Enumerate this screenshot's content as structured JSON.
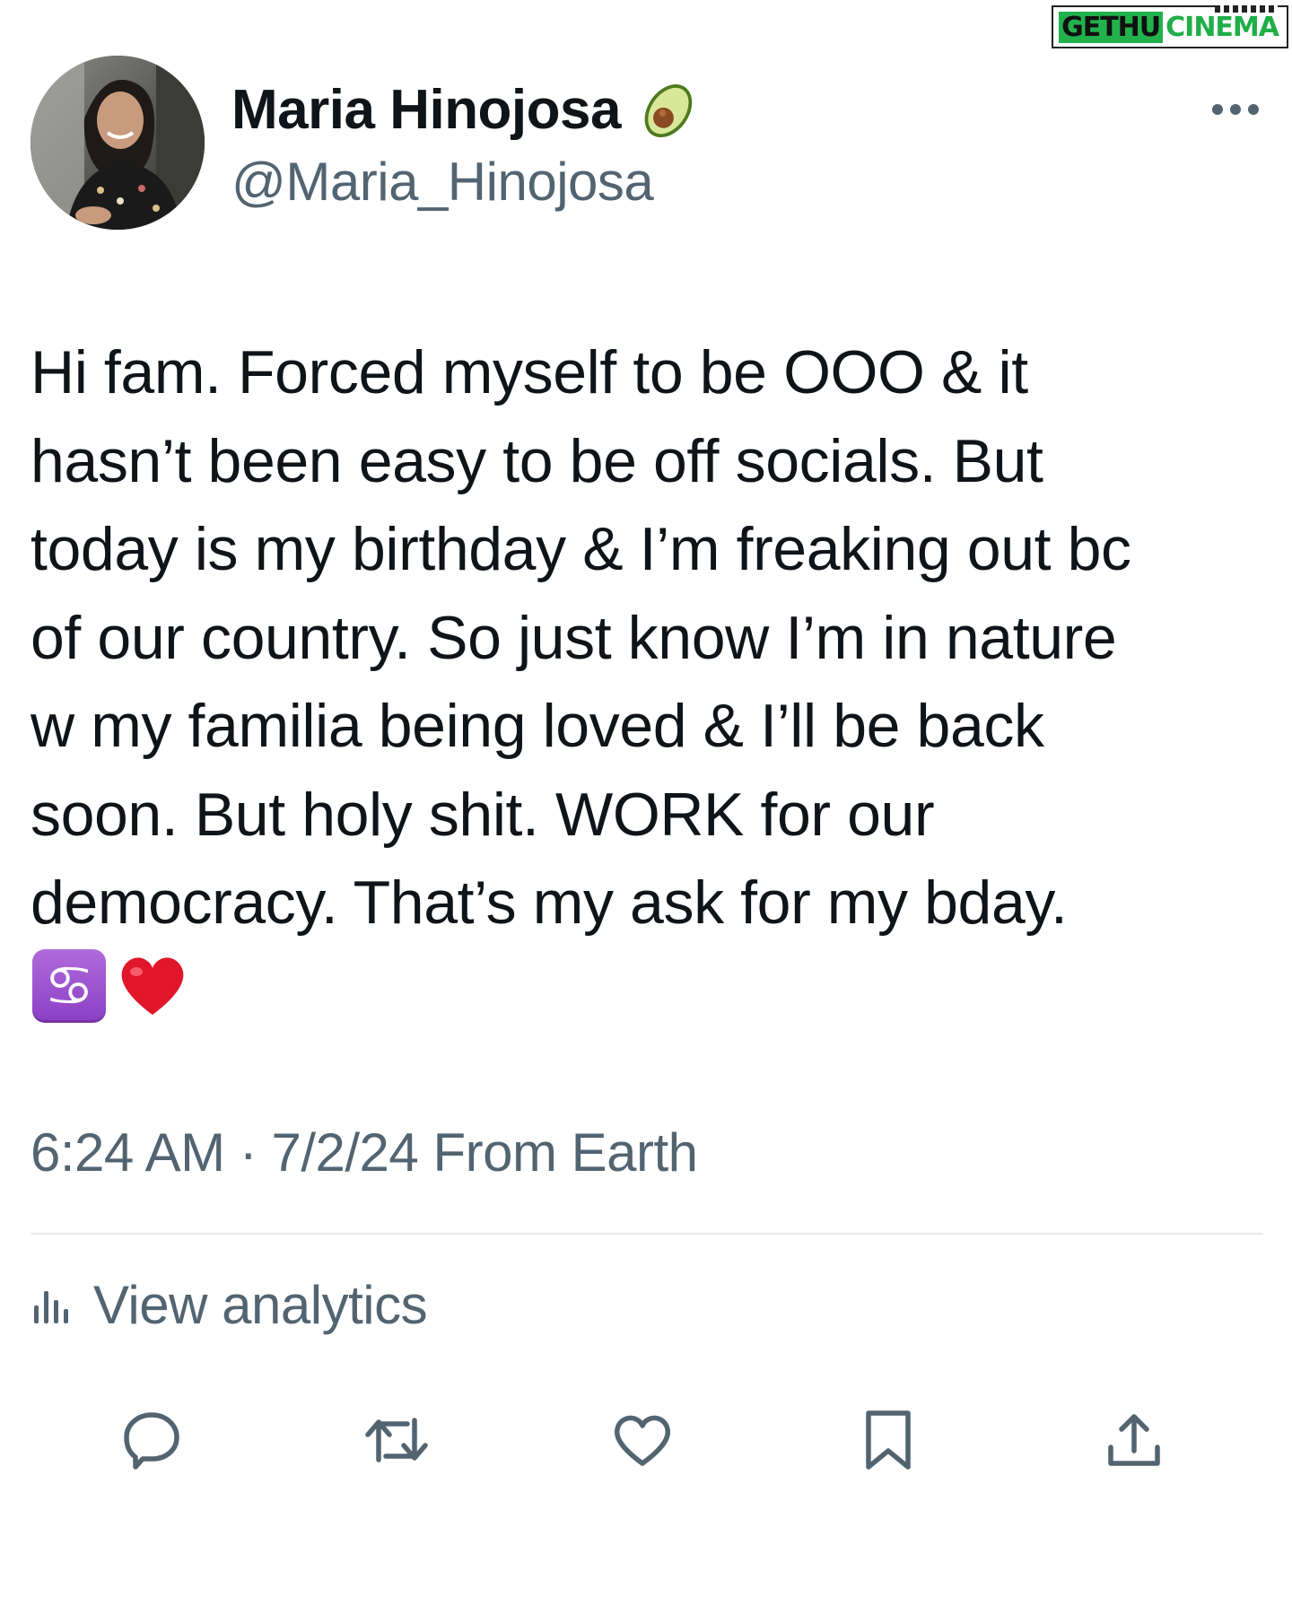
{
  "watermark": {
    "part1": "GETHU",
    "part2": "CINEMA"
  },
  "author": {
    "display_name": "Maria Hinojosa",
    "handle": "@Maria_Hinojosa"
  },
  "tweet": {
    "text": "Hi fam. Forced myself to be OOO & it\nhasn’t been easy to be off socials. But\ntoday is my birthday & I’m freaking out bc\nof our country. So just know I’m in nature\nw my familia being loved & I’ll be back\nsoon. But holy shit. WORK for our\ndemocracy. That’s my ask for my bday.",
    "emojis": [
      "cancer-zodiac-emoji",
      "red-heart-emoji"
    ],
    "cancer_glyph": "♋",
    "timestamp": "6:24 AM · 7/2/24 From Earth"
  },
  "analytics": {
    "label": "View analytics"
  },
  "actions": [
    "reply-icon",
    "retweet-icon",
    "like-icon",
    "bookmark-icon",
    "share-icon"
  ],
  "colors": {
    "text_primary": "#0f1419",
    "text_secondary": "#536471",
    "divider": "#e6e9ec",
    "emoji_purple": "#9a4fd0",
    "heart_red": "#e0162b"
  }
}
